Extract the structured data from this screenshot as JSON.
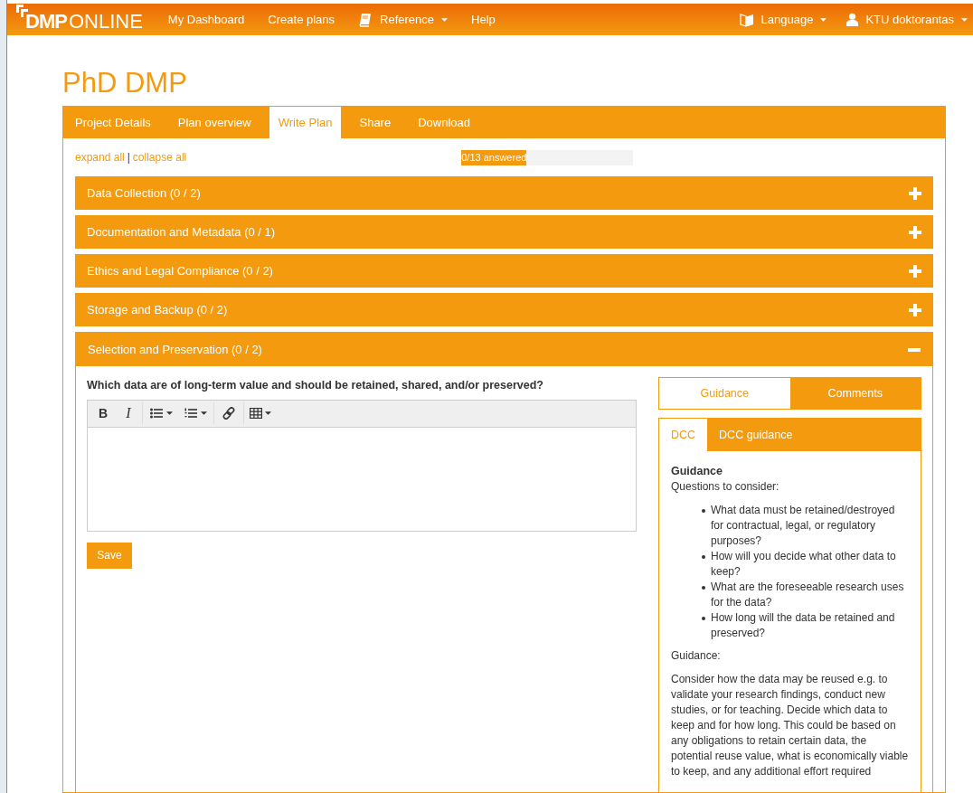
{
  "navbar": {
    "logo_bold": "DMP",
    "logo_light": "ONLINE",
    "links": [
      {
        "label": "My Dashboard",
        "kind": "plain",
        "dropdown": false
      },
      {
        "label": "Create plans",
        "kind": "plain",
        "dropdown": false
      },
      {
        "label": "Reference",
        "kind": "reference",
        "dropdown": true
      },
      {
        "label": "Help",
        "kind": "plain",
        "dropdown": false
      }
    ],
    "right": [
      {
        "label": "Language",
        "kind": "language",
        "dropdown": true
      },
      {
        "label": "KTU doktorantas",
        "kind": "account",
        "dropdown": true
      }
    ]
  },
  "title": "PhD DMP",
  "tabs": [
    {
      "label": "Project Details",
      "selected": false
    },
    {
      "label": "Plan overview",
      "selected": false
    },
    {
      "label": "Write Plan",
      "selected": true
    },
    {
      "label": "Share",
      "selected": false
    },
    {
      "label": "Download",
      "selected": false
    }
  ],
  "expand_all": "expand all",
  "separator": "|",
  "collapse_all": "collapse all",
  "progress": {
    "label": "0/13 answered",
    "level": 0.38
  },
  "sections": [
    {
      "title": "Data Collection (0 / 2)",
      "expanded": false
    },
    {
      "title": "Documentation and Metadata (0 / 1)",
      "expanded": false
    },
    {
      "title": "Ethics and Legal Compliance (0 / 2)",
      "expanded": false
    },
    {
      "title": "Storage and Backup (0 / 2)",
      "expanded": false
    },
    {
      "title": "Selection and Preservation (0 / 2)",
      "expanded": true
    }
  ],
  "question": "Which data are of long-term value and should be retained, shared, and/or preserved?",
  "editor": {
    "toolbar": [
      {
        "kind": "bold",
        "label": "B"
      },
      {
        "kind": "italic",
        "label": "I"
      },
      {
        "kind": "bullets"
      },
      {
        "kind": "numbers"
      },
      {
        "kind": "link"
      },
      {
        "kind": "table"
      }
    ]
  },
  "save_button": "Save",
  "side_tabs": [
    {
      "label": "Guidance",
      "selected": true
    },
    {
      "label": "Comments",
      "selected": false
    }
  ],
  "guidance_tabs": [
    {
      "label": "DCC",
      "selected": true
    },
    {
      "label": "DCC guidance",
      "selected": false
    }
  ],
  "guidance": {
    "heading": "Guidance",
    "intro": "Questions to consider:",
    "questions": [
      "What data must be retained/destroyed for contractual, legal, or regulatory purposes?",
      "How will you decide what other data to keep?",
      "What are the foreseeable research uses for the data?",
      "How long will the data be retained and preserved?"
    ],
    "subheading": "Guidance:",
    "paragraph": "Consider how the data may be reused e.g. to validate your research findings, conduct new studies, or for teaching. Decide which data to keep and for how long. This could be based on any obligations to retain certain data, the potential reuse value, what is economically viable to keep, and any additional effort required"
  }
}
